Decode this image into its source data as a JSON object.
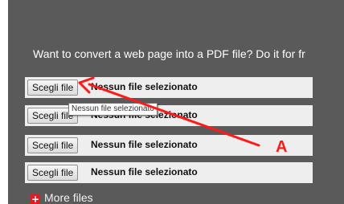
{
  "intro_text": "Want to convert a web page into a PDF file? Do it for fr",
  "file_inputs": [
    {
      "button_label": "Scegli file",
      "status": "Nessun file selezionato"
    },
    {
      "button_label": "Scegli file",
      "status": "Nessun file selezionato"
    },
    {
      "button_label": "Scegli file",
      "status": "Nessun file selezionato"
    },
    {
      "button_label": "Scegli file",
      "status": "Nessun file selezionato"
    }
  ],
  "tooltip_text": "Nessun file selezionato",
  "more_files": {
    "icon": "plus-icon",
    "label": "More files"
  },
  "annotation": {
    "label": "A",
    "color": "#ff1a1a"
  },
  "colors": {
    "panel": "#5a5a5a",
    "row": "#eeeeee",
    "plus": "#e41b23"
  }
}
